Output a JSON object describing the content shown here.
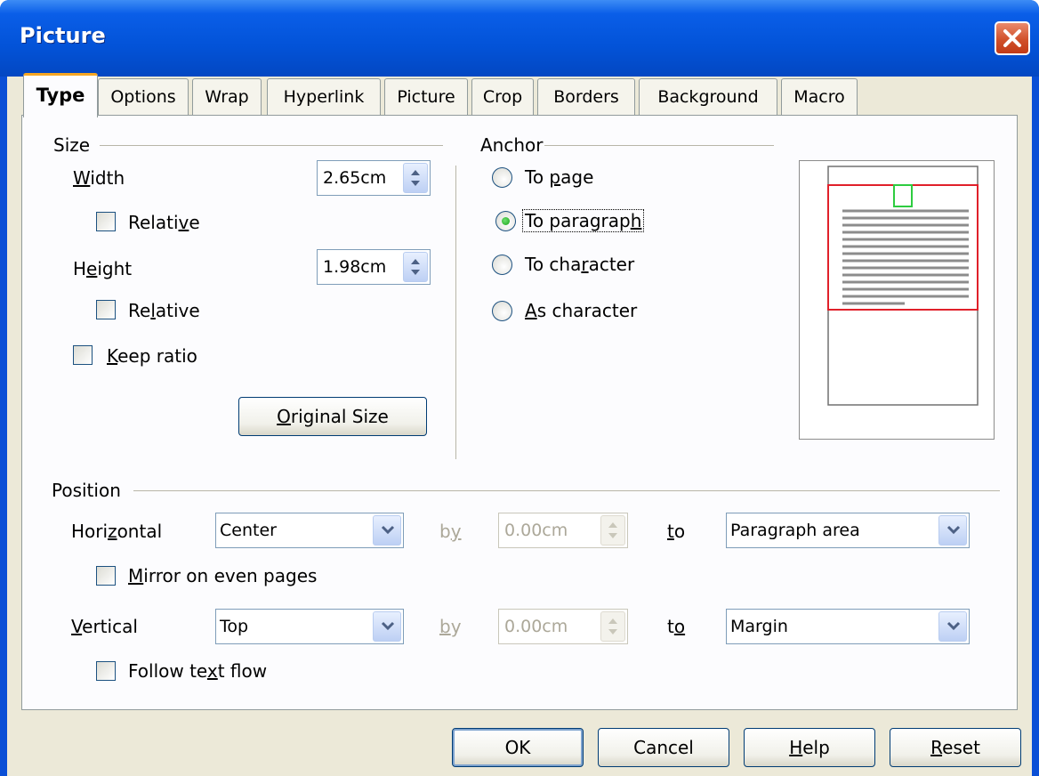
{
  "window": {
    "title": "Picture"
  },
  "tabs": [
    "Type",
    "Options",
    "Wrap",
    "Hyperlink",
    "Picture",
    "Crop",
    "Borders",
    "Background",
    "Macro"
  ],
  "size": {
    "label": "Size",
    "width_label": "Width",
    "width_value": "2.65cm",
    "width_relative_label": "Relative",
    "width_relative_checked": false,
    "height_label": "Height",
    "height_value": "1.98cm",
    "height_relative_label": "Relative",
    "height_relative_checked": false,
    "keep_ratio_label": "Keep ratio",
    "keep_ratio_checked": false,
    "original_size_button": "Original Size"
  },
  "anchor": {
    "label": "Anchor",
    "options": [
      "To page",
      "To paragraph",
      "To character",
      "As character"
    ],
    "selected": "To paragraph"
  },
  "position": {
    "label": "Position",
    "horizontal_label": "Horizontal",
    "horizontal_value": "Center",
    "horizontal_by_label": "by",
    "horizontal_by_value": "0.00cm",
    "horizontal_to_label": "to",
    "horizontal_to_value": "Paragraph area",
    "mirror_label": "Mirror on even pages",
    "mirror_checked": false,
    "vertical_label": "Vertical",
    "vertical_value": "Top",
    "vertical_by_label": "by",
    "vertical_by_value": "0.00cm",
    "vertical_to_label": "to",
    "vertical_to_value": "Margin",
    "follow_label": "Follow text flow",
    "follow_checked": false
  },
  "buttons": {
    "ok": "OK",
    "cancel": "Cancel",
    "help": "Help",
    "reset": "Reset"
  },
  "colors": {
    "titlebar": "#0353d8",
    "tab_highlight": "#f5a623",
    "preview_frame": "#e0202a",
    "preview_picture": "#2ecc40"
  }
}
